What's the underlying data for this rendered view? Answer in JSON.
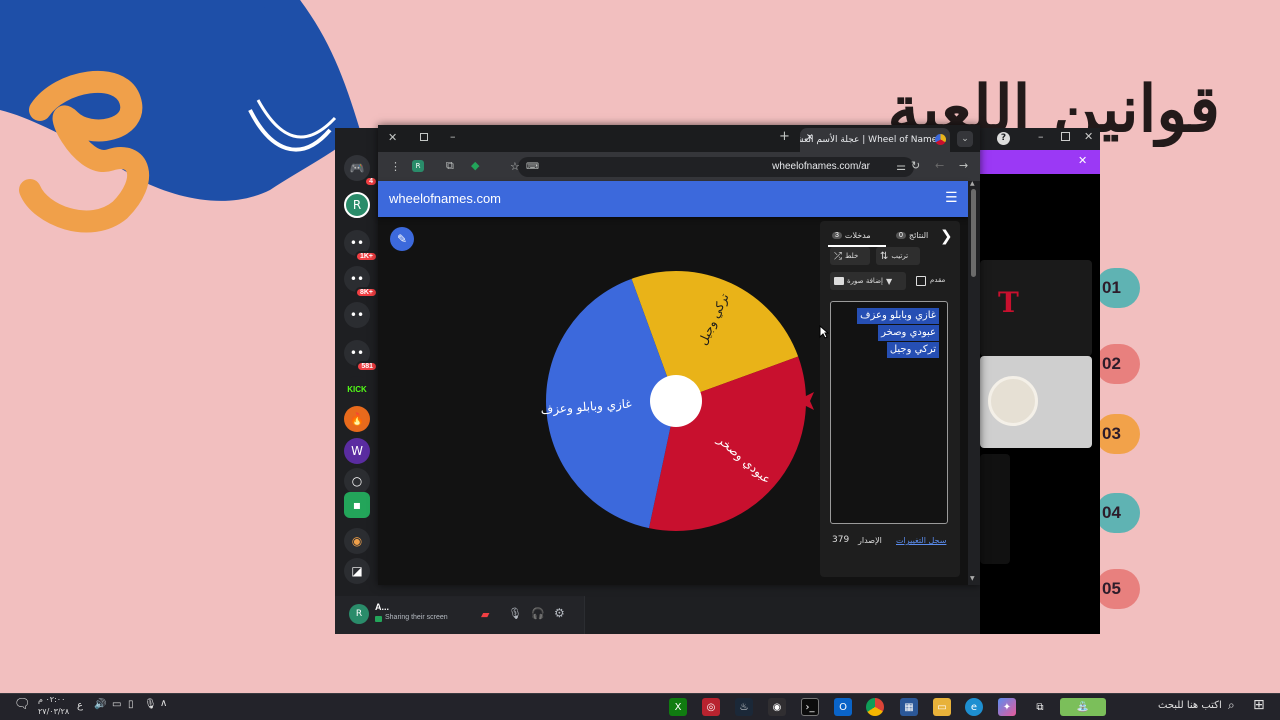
{
  "slide": {
    "title": "قوانين اللعبة",
    "numbers": [
      {
        "label": "01",
        "color": "#5fb3b3"
      },
      {
        "label": "02",
        "color": "#e8807e"
      },
      {
        "label": "03",
        "color": "#f2a24a"
      },
      {
        "label": "04",
        "color": "#5fb3b3"
      },
      {
        "label": "05",
        "color": "#e8807e"
      }
    ]
  },
  "browser": {
    "tab_title": "Wheel of Names | عجلة الأسم العشوائي",
    "url": "wheelofnames.com/ar"
  },
  "site": {
    "brand": "wheelofnames.com",
    "tabs": {
      "entries_label": "مدخلات",
      "entries_count": "3",
      "results_label": "النتائج",
      "results_count": "0"
    },
    "buttons": {
      "shuffle": "خلط",
      "sort": "ترتيب",
      "add_image": "إضافة صورة",
      "advanced": "مقدم"
    },
    "entries": [
      "غازي وبابلو وعزف",
      "عبودي وصخر",
      "تركي وجيل"
    ],
    "version_label": "الإصدار",
    "version_number": "379",
    "changelog_link": "سجل التغييرات"
  },
  "wheel": {
    "slices": [
      {
        "label": "تركي وجيل",
        "color": "#e9b318",
        "start": -110,
        "end": -20
      },
      {
        "label": "عبودي وصخر",
        "color": "#c8102e",
        "start": -20,
        "end": 102
      },
      {
        "label": "غازي وبابلو وعزف",
        "color": "#3c69dc",
        "start": 102,
        "end": 250
      }
    ],
    "pointer_color": "#c8102e"
  },
  "discord": {
    "user_name": "A...",
    "status": "Sharing their screen",
    "badges": [
      "4",
      "1K+",
      "8K+",
      "581"
    ],
    "kick_label": "KICK"
  },
  "taskbar": {
    "search_placeholder": "اكتب هنا للبحث",
    "time": "٠٢:٠٠ م",
    "date": "٢٧/٠٣/٢٨",
    "lang": "ع"
  }
}
